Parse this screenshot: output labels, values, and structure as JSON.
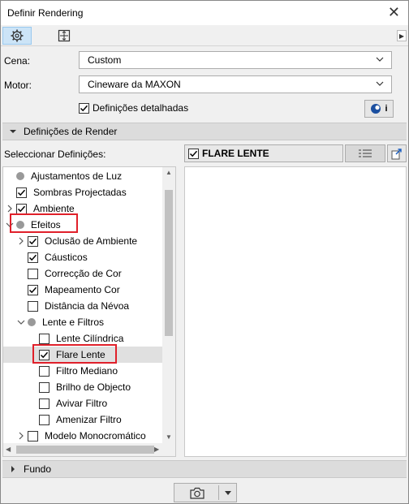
{
  "window": {
    "title": "Definir Rendering"
  },
  "fields": {
    "cena_label": "Cena:",
    "cena_value": "Custom",
    "motor_label": "Motor:",
    "motor_value": "Cineware da MAXON",
    "detailed_label": "Definições detalhadas",
    "detailed_checked": true
  },
  "sections": {
    "render": "Definições de Render",
    "fundo": "Fundo"
  },
  "selector": {
    "label": "Seleccionar Definições:",
    "selected_title": "FLARE LENTE"
  },
  "tree": [
    {
      "label": "Ajustamentos de Luz",
      "level": 1,
      "kind": "dot",
      "expander": "none"
    },
    {
      "label": "Sombras Projectadas",
      "level": 1,
      "kind": "check",
      "checked": true,
      "expander": "none"
    },
    {
      "label": "Ambiente",
      "level": 1,
      "kind": "check",
      "checked": true,
      "expander": "right"
    },
    {
      "label": "Efeitos",
      "level": 1,
      "kind": "dot",
      "expander": "down"
    },
    {
      "label": "Oclusão de Ambiente",
      "level": 2,
      "kind": "check",
      "checked": true,
      "expander": "right"
    },
    {
      "label": "Cáusticos",
      "level": 2,
      "kind": "check",
      "checked": true,
      "expander": "none"
    },
    {
      "label": "Correcção de Cor",
      "level": 2,
      "kind": "check",
      "checked": false,
      "expander": "none"
    },
    {
      "label": "Mapeamento Cor",
      "level": 2,
      "kind": "check",
      "checked": true,
      "expander": "none"
    },
    {
      "label": "Distância da Névoa",
      "level": 2,
      "kind": "check",
      "checked": false,
      "expander": "none"
    },
    {
      "label": "Lente e Filtros",
      "level": 2,
      "kind": "dot",
      "expander": "down"
    },
    {
      "label": "Lente Cilíndrica",
      "level": 3,
      "kind": "check",
      "checked": false,
      "expander": "none"
    },
    {
      "label": "Flare Lente",
      "level": 3,
      "kind": "check",
      "checked": true,
      "expander": "none",
      "selected": true
    },
    {
      "label": "Filtro Mediano",
      "level": 3,
      "kind": "check",
      "checked": false,
      "expander": "none"
    },
    {
      "label": "Brilho de Objecto",
      "level": 3,
      "kind": "check",
      "checked": false,
      "expander": "none"
    },
    {
      "label": "Avivar Filtro",
      "level": 3,
      "kind": "check",
      "checked": false,
      "expander": "none"
    },
    {
      "label": "Amenizar Filtro",
      "level": 3,
      "kind": "check",
      "checked": false,
      "expander": "none"
    },
    {
      "label": "Modelo Monocromático",
      "level": 2,
      "kind": "check",
      "checked": false,
      "expander": "right"
    }
  ],
  "icons": {
    "settings_tab": "gear-icon",
    "size_tab": "resize-icon",
    "camera": "camera-icon",
    "cineware": "cineware-info-icon",
    "list_view": "list-view-icon",
    "export": "export-icon"
  },
  "colors": {
    "highlight": "#e0202a",
    "active_tab": "#cce4f7"
  }
}
